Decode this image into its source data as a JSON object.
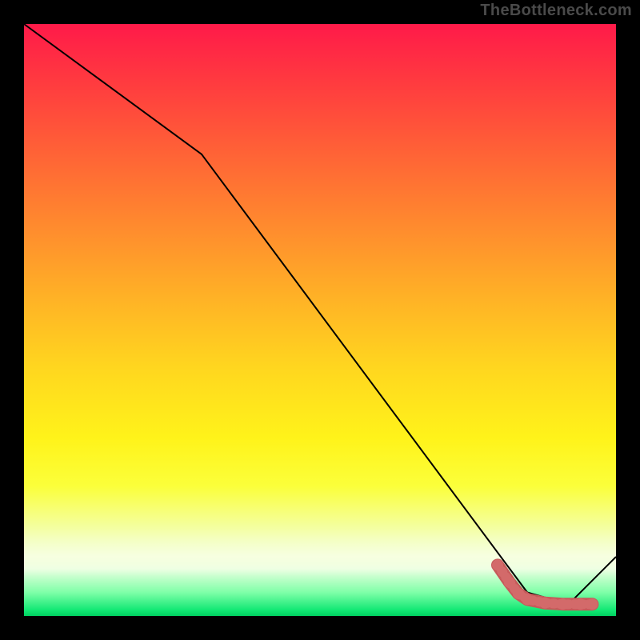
{
  "watermark": "TheBottleneck.com",
  "colors": {
    "line_black": "#000000",
    "curve_red": "#d36a6a",
    "curve_fill": "#c65a5a"
  },
  "chart_data": {
    "type": "line",
    "title": "",
    "xlabel": "",
    "ylabel": "",
    "xlim": [
      0,
      100
    ],
    "ylim": [
      0,
      100
    ],
    "grid": false,
    "series": [
      {
        "name": "black-line",
        "x": [
          0,
          30,
          85,
          92,
          100
        ],
        "values": [
          100,
          78,
          4,
          2,
          10
        ]
      },
      {
        "name": "red-curve",
        "x": [
          80,
          82,
          83.5,
          85,
          88,
          91,
          94,
          96
        ],
        "values": [
          8.6,
          5.7,
          3.8,
          2.8,
          2.2,
          2.0,
          2.0,
          2.0
        ]
      }
    ]
  }
}
